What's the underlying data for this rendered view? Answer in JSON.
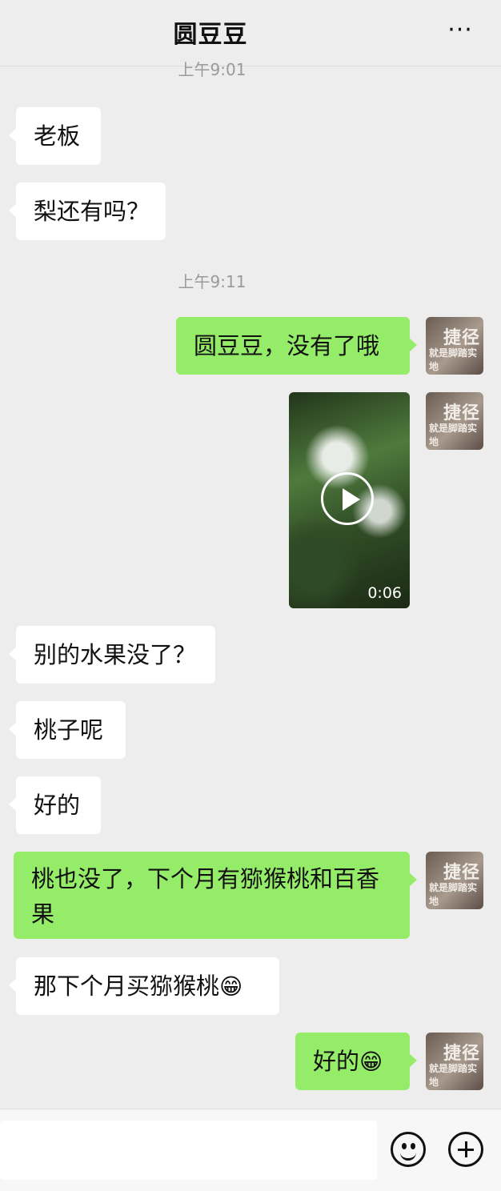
{
  "header": {
    "title": "圆豆豆",
    "more_icon": "more-dots-icon",
    "more_label": "···"
  },
  "timestamps": [
    "上午9:01",
    "上午9:11"
  ],
  "messages": [
    {
      "from": "them",
      "text": "老板"
    },
    {
      "from": "them",
      "text": "梨还有吗？"
    },
    {
      "from": "me",
      "text": "圆豆豆，没有了哦"
    },
    {
      "from": "me",
      "type": "video",
      "duration": "0:06"
    },
    {
      "from": "them",
      "text": "别的水果没了？"
    },
    {
      "from": "them",
      "text": "桃子呢"
    },
    {
      "from": "them",
      "text": "好的"
    },
    {
      "from": "me",
      "text": "桃也没了，下个月有猕猴桃和百香果"
    },
    {
      "from": "them",
      "text": "那下个月买猕猴桃",
      "emoji": "😁"
    },
    {
      "from": "me",
      "text": "好的",
      "emoji": "😁"
    }
  ],
  "avatar": {
    "text_big": "捷径",
    "text_small": "就是脚踏实地"
  },
  "input_bar": {
    "placeholder": "",
    "emoji_icon": "smiley-icon",
    "more_icon": "plus-icon"
  }
}
